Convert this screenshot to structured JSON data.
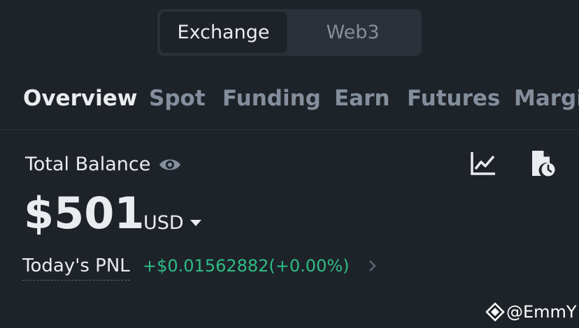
{
  "segmented": {
    "options": [
      "Exchange",
      "Web3"
    ],
    "selected": "Exchange"
  },
  "tabs": [
    "Overview",
    "Spot",
    "Funding",
    "Earn",
    "Futures",
    "Margin"
  ],
  "active_tab": "Overview",
  "balance": {
    "label": "Total Balance",
    "amount": "$501",
    "currency": "USD",
    "pnl_label": "Today's PNL",
    "pnl_value": "+$0.01562882(+0.00%)"
  },
  "icons": {
    "visibility": "eye-icon",
    "chart": "line-chart-icon",
    "history": "history-icon",
    "pnl_arrow": "chevron-right-icon"
  },
  "watermark": {
    "text": "@EmmY"
  },
  "colors": {
    "background": "#1e2329",
    "surface": "#2b3139",
    "text_primary": "#eaecef",
    "text_muted": "#848e9c",
    "positive": "#2ebd85"
  }
}
